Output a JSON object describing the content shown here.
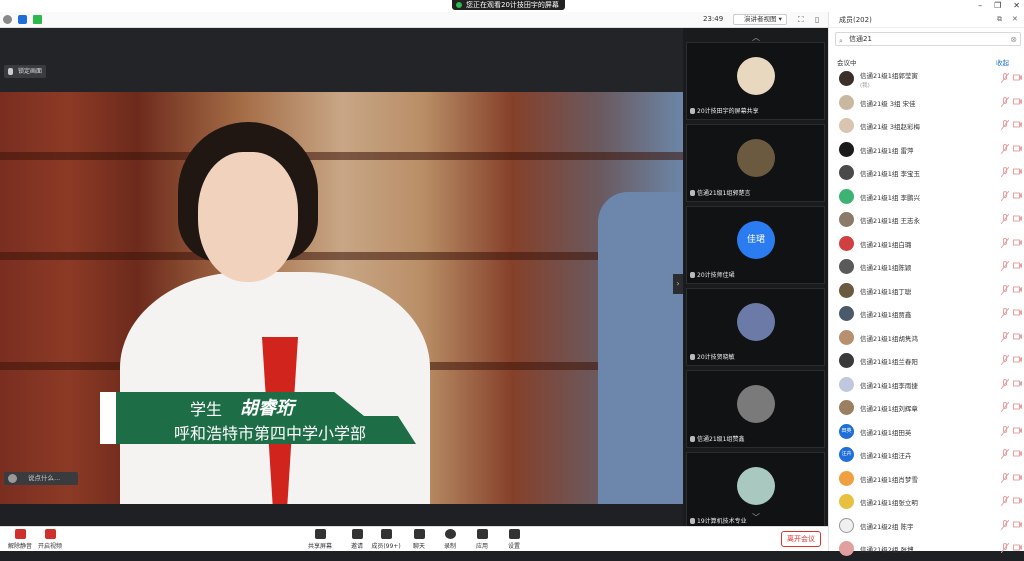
{
  "top": {
    "notice": "您正在观看20计技田宇的屏幕",
    "winbtns": [
      "–",
      "❐",
      "✕"
    ]
  },
  "toolbar": {
    "time": "23:49",
    "view_label": "演讲者视图"
  },
  "video": {
    "lock_label": "锁定画面",
    "caption_role": "学生",
    "caption_name": "胡睿珩",
    "caption_school": "呼和浩特市第四中学小学部",
    "chat_placeholder": "说点什么..."
  },
  "thumbs": [
    {
      "label": "20计技田宇的屏幕共享",
      "color": "#e8d8c0"
    },
    {
      "label": "信通21级1组郭楚言",
      "color": "#6b5a40"
    },
    {
      "label": "20计技师佳珺",
      "color": "#2a7cf0",
      "initials": "佳珺"
    },
    {
      "label": "20计技贺晓敏",
      "color": "#6c7aa8"
    },
    {
      "label": "信通21级1组赞鑫",
      "color": "#7a7a7a"
    },
    {
      "label": "19计算机技术专业",
      "color": "#a8c8c0"
    }
  ],
  "panel": {
    "title": "成员(202)",
    "search_value": "信通21",
    "section": "会议中",
    "fold": "收起",
    "members": [
      {
        "name": "信通21级1组郭莹寅",
        "sub": "(我)",
        "color": "#3a3028"
      },
      {
        "name": "信通21级 3组 宋佳",
        "sub": "",
        "color": "#c8b8a0"
      },
      {
        "name": "信通21级 3组赵彩梅",
        "sub": "",
        "color": "#d9c4b0"
      },
      {
        "name": "信通21级1组 雷萍",
        "sub": "",
        "color": "#1a1a1a"
      },
      {
        "name": "信通21级1组 李宝玉",
        "sub": "",
        "color": "#4a4a4a"
      },
      {
        "name": "信通21级1组 李鹏兴",
        "sub": "",
        "color": "#3cb371"
      },
      {
        "name": "信通21级1组 王志永",
        "sub": "",
        "color": "#8a7a6a"
      },
      {
        "name": "信通21级1组白璐",
        "sub": "",
        "color": "#d04040"
      },
      {
        "name": "信通21级1组陈颖",
        "sub": "",
        "color": "#5a5a5a"
      },
      {
        "name": "信通21级1组丁聪",
        "sub": "",
        "color": "#6a5a40"
      },
      {
        "name": "信通21级1组贾鑫",
        "sub": "",
        "color": "#4a5a6a"
      },
      {
        "name": "信通21级1组胡隽鸿",
        "sub": "",
        "color": "#b89070"
      },
      {
        "name": "信通21级1组兰春阳",
        "sub": "",
        "color": "#3a3a3a"
      },
      {
        "name": "信通21级1组李雨捷",
        "sub": "",
        "color": "#c0c8e0"
      },
      {
        "name": "信通21级1组刘辉章",
        "sub": "",
        "color": "#9a8060"
      },
      {
        "name": "信通21级1组田英",
        "sub": "",
        "color": "#1e6fd9",
        "initials": "田英"
      },
      {
        "name": "信通21级1组汪卉",
        "sub": "",
        "color": "#1e6fd9",
        "initials": "汪卉"
      },
      {
        "name": "信通21级1组肖梦雪",
        "sub": "",
        "color": "#f0a040"
      },
      {
        "name": "信通21级1组张立明",
        "sub": "",
        "color": "#e8c040"
      },
      {
        "name": "信通21级2组 陈宇",
        "sub": "",
        "color": "#f0f0f0"
      },
      {
        "name": "信通21级2组 张博",
        "sub": "",
        "color": "#e0a0a0"
      }
    ]
  },
  "bottom": {
    "buttons": [
      "解除静音",
      "开启视频",
      "共享屏幕",
      "邀请",
      "成员(99+)",
      "聊天",
      "录制",
      "应用",
      "设置"
    ],
    "leave": "离开会议"
  }
}
